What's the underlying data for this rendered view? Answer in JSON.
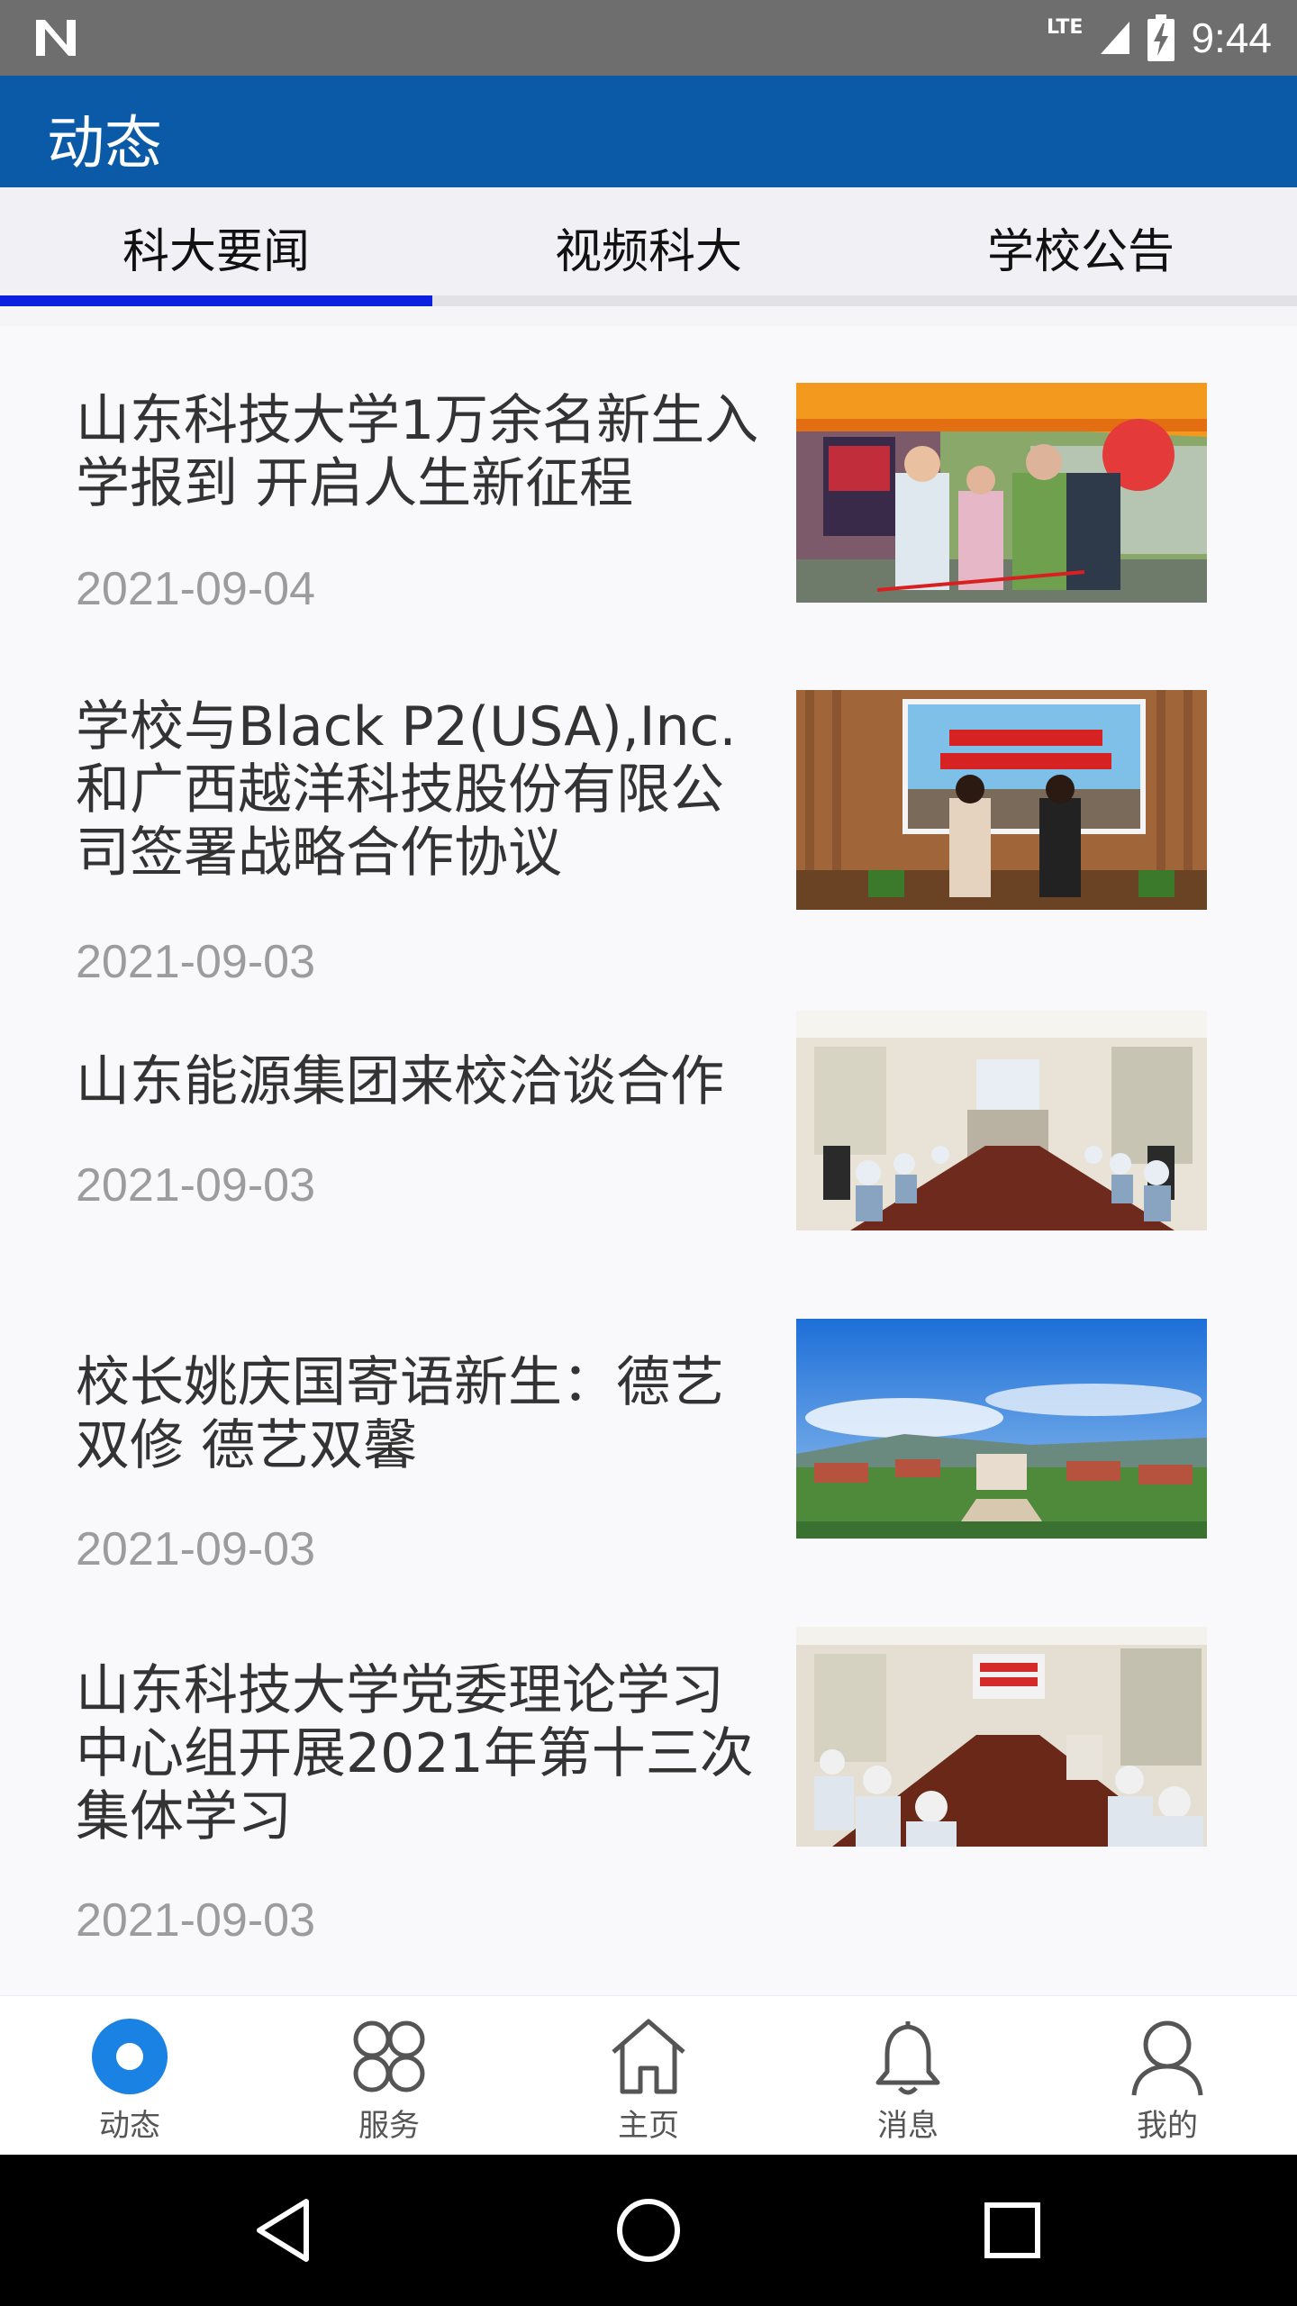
{
  "status_bar": {
    "network": "LTE",
    "time": "9:44",
    "icons": [
      "notification-n-icon",
      "signal-icon",
      "battery-charging-icon"
    ]
  },
  "app_bar": {
    "title": "动态"
  },
  "tabs": [
    {
      "label": "科大要闻",
      "selected": true
    },
    {
      "label": "视频科大",
      "selected": false
    },
    {
      "label": "学校公告",
      "selected": false
    }
  ],
  "news": [
    {
      "title": "山东科技大学1万余名新生入学报到 开启人生新征程",
      "date": "2021-09-04"
    },
    {
      "title": "学校与Black P2(USA),Inc.和广西越洋科技股份有限公司签署战略合作协议",
      "date": "2021-09-03"
    },
    {
      "title": "山东能源集团来校洽谈合作",
      "date": "2021-09-03"
    },
    {
      "title": "校长姚庆国寄语新生：德艺双修 德艺双馨",
      "date": "2021-09-03"
    },
    {
      "title": "山东科技大学党委理论学习中心组开展2021年第十三次集体学习",
      "date": "2021-09-03"
    }
  ],
  "bottom_nav": [
    {
      "label": "动态",
      "icon": "news-dot-icon",
      "active": true
    },
    {
      "label": "服务",
      "icon": "grid-icon",
      "active": false
    },
    {
      "label": "主页",
      "icon": "home-icon",
      "active": false
    },
    {
      "label": "消息",
      "icon": "bell-icon",
      "active": false
    },
    {
      "label": "我的",
      "icon": "user-icon",
      "active": false
    }
  ],
  "system_nav": [
    "back-icon",
    "home-circle-icon",
    "recents-icon"
  ],
  "colors": {
    "app_bar": "#0b5aa8",
    "tab_indicator": "#0c21e0",
    "nav_active": "#1a82e2"
  }
}
